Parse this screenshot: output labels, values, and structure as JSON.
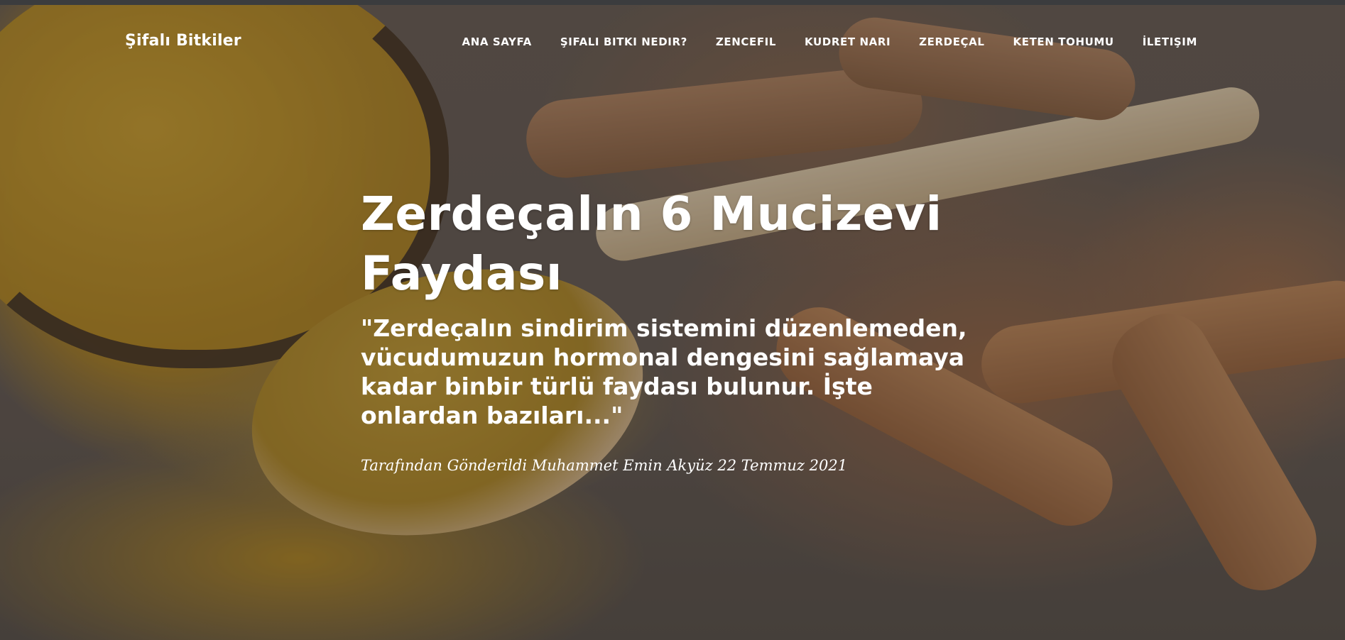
{
  "nav": {
    "brand": "Şifalı Bitkiler",
    "items": [
      {
        "label": "ANA SAYFA"
      },
      {
        "label": "ŞIFALI BITKI NEDIR?"
      },
      {
        "label": "ZENCEFIL"
      },
      {
        "label": "KUDRET NARI"
      },
      {
        "label": "ZERDEÇAL"
      },
      {
        "label": "KETEN TOHUMU"
      },
      {
        "label": "İLETIŞIM"
      }
    ]
  },
  "post": {
    "title": "Zerdeçalın 6 Mucizevi Faydası",
    "subtitle": "\"Zerdeçalın sindirim sistemini düzenlemeden, vücudumuzun hormonal dengesini sağlamaya kadar binbir türlü faydası bulunur. İşte onlardan bazıları...\"",
    "meta": "Tarafından Gönderildi Muhammet Emin Akyüz 22 Temmuz 2021"
  },
  "colors": {
    "text": "#ffffff",
    "overlay": "#14100c"
  }
}
